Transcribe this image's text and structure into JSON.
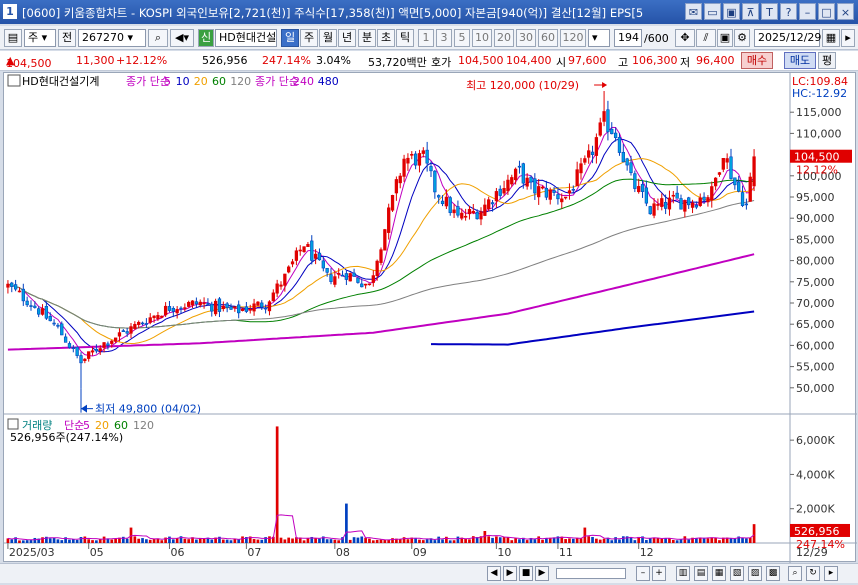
{
  "window": {
    "num": "1",
    "title": "[0600] 키움종합차트 - KOSPI 외국인보유[2,721(천)] 주식수[17,358(천)] 액면[5,000] 자본금[940(억)] 결산[12월] EPS[5",
    "controls": [
      "✉",
      "▭",
      "▣",
      "⊼",
      "T",
      "?",
      "–",
      "□",
      "×"
    ]
  },
  "toolbar": {
    "market": "주",
    "jeon": "전",
    "code": "267270",
    "stock_badge": "신",
    "stock_name": "HD현대건설",
    "periods": [
      "일",
      "주",
      "월",
      "년",
      "분",
      "초",
      "틱"
    ],
    "intervals": [
      "1",
      "3",
      "5",
      "10",
      "20",
      "30",
      "60",
      "120"
    ],
    "count": "194",
    "count_total": "/600",
    "date": "2025/12/29"
  },
  "quote": {
    "price": "104,500",
    "change": "11,300",
    "change_pct": "+12.12%",
    "volume": "526,956",
    "vol_ratio": "247.14%",
    "turnover": "3.04%",
    "amount": "53,720백만",
    "ask_label": "호가",
    "ask": "104,500",
    "bid": "104,400",
    "open_label": "시",
    "open": "97,600",
    "high_label": "고",
    "high": "106,300",
    "low_label": "저",
    "low": "96,400",
    "buy_btn": "매수",
    "sell_btn": "매도",
    "eval_btn": "평"
  },
  "chart_data": {
    "type": "candlestick",
    "stock_label": "HD현대건설기계",
    "legend": [
      {
        "text": "종가 단순",
        "color": "#c000c0"
      },
      {
        "text": "5",
        "color": "#c000c0"
      },
      {
        "text": "10",
        "color": "#0000c0"
      },
      {
        "text": "20",
        "color": "#f0a000"
      },
      {
        "text": "60",
        "color": "#008000"
      },
      {
        "text": "120",
        "color": "#808080"
      },
      {
        "text": "종가 단순",
        "color": "#c000c0"
      },
      {
        "text": "240",
        "color": "#c000c0"
      },
      {
        "text": "480",
        "color": "#0000c0"
      }
    ],
    "lc": "LC:109.84",
    "hc": "HC:-12.92",
    "ylim": [
      45000,
      120000
    ],
    "yticks": [
      50000,
      55000,
      60000,
      65000,
      70000,
      75000,
      80000,
      85000,
      90000,
      95000,
      100000,
      105000,
      110000,
      115000
    ],
    "ytick_labels": [
      "50,000",
      "55,000",
      "60,000",
      "65,000",
      "70,000",
      "75,000",
      "80,000",
      "85,000",
      "90,000",
      "95,000",
      "100,000",
      "105,000",
      "110,000",
      "115,000"
    ],
    "current_price": 104500,
    "current_label": "104,500",
    "current_pct": "12.12%",
    "high_annotation": "최고 120,000 (10/29)",
    "high_value": 120000,
    "low_annotation": "최저 49,800 (04/02)",
    "low_value": 49800,
    "ohlc_anchors": [
      [
        "2025-03-04",
        74000
      ],
      [
        "2025-03-14",
        70000
      ],
      [
        "2025-03-24",
        64000
      ],
      [
        "2025-04-02",
        56000
      ],
      [
        "2025-04-10",
        60000
      ],
      [
        "2025-04-22",
        64000
      ],
      [
        "2025-05-08",
        69000
      ],
      [
        "2025-05-20",
        70000
      ],
      [
        "2025-06-03",
        68000
      ],
      [
        "2025-06-16",
        70000
      ],
      [
        "2025-06-24",
        76000
      ],
      [
        "2025-07-01",
        84000
      ],
      [
        "2025-07-10",
        76000
      ],
      [
        "2025-07-18",
        77000
      ],
      [
        "2025-07-28",
        74000
      ],
      [
        "2025-08-04",
        91000
      ],
      [
        "2025-08-11",
        104000
      ],
      [
        "2025-08-18",
        104000
      ],
      [
        "2025-08-22",
        97000
      ],
      [
        "2025-09-01",
        90000
      ],
      [
        "2025-09-10",
        92000
      ],
      [
        "2025-09-18",
        97000
      ],
      [
        "2025-09-25",
        101000
      ],
      [
        "2025-10-01",
        97000
      ],
      [
        "2025-10-14",
        95000
      ],
      [
        "2025-10-23",
        104000
      ],
      [
        "2025-10-29",
        113000
      ],
      [
        "2025-11-03",
        110000
      ],
      [
        "2025-11-10",
        99000
      ],
      [
        "2025-11-18",
        92000
      ],
      [
        "2025-11-26",
        94000
      ],
      [
        "2025-12-04",
        94000
      ],
      [
        "2025-12-12",
        96000
      ],
      [
        "2025-12-17",
        106000
      ],
      [
        "2025-12-22",
        98000
      ],
      [
        "2025-12-26",
        93000
      ],
      [
        "2025-12-29",
        104500
      ]
    ],
    "ma240": [
      [
        0,
        59000
      ],
      [
        50,
        60500
      ],
      [
        95,
        63000
      ],
      [
        130,
        67500
      ],
      [
        160,
        74000
      ],
      [
        194,
        81500
      ]
    ],
    "ma480": [
      [
        110,
        60300
      ],
      [
        130,
        60200
      ],
      [
        160,
        64000
      ],
      [
        194,
        68000
      ]
    ],
    "volume_panel": {
      "title": "거래량",
      "legend": [
        {
          "text": "단순",
          "color": "#c000c0"
        },
        {
          "text": "5",
          "color": "#c000c0"
        },
        {
          "text": "20",
          "color": "#f0a000"
        },
        {
          "text": "60",
          "color": "#008000"
        },
        {
          "text": "120",
          "color": "#808080"
        }
      ],
      "value_label": "526,956주(247.14%)",
      "ylim": [
        0,
        7000000
      ],
      "yticks": [
        2000000,
        4000000,
        6000000
      ],
      "ytick_labels": [
        "2,000K",
        "4,000K",
        "6,000K"
      ],
      "current": 526956,
      "current_label": "526,956",
      "current_pct": "247.14%",
      "spikes": [
        [
          32,
          900000
        ],
        [
          70,
          6800000
        ],
        [
          88,
          2300000
        ],
        [
          124,
          700000
        ],
        [
          150,
          900000
        ],
        [
          194,
          1100000
        ]
      ]
    },
    "x_labels": [
      {
        "i": 0,
        "t": "2025/03"
      },
      {
        "i": 21,
        "t": "05"
      },
      {
        "i": 42,
        "t": "06"
      },
      {
        "i": 62,
        "t": "07"
      },
      {
        "i": 85,
        "t": "08"
      },
      {
        "i": 105,
        "t": "09"
      },
      {
        "i": 127,
        "t": "10"
      },
      {
        "i": 143,
        "t": "11"
      },
      {
        "i": 164,
        "t": "12"
      }
    ],
    "x_end_label": "12/29"
  }
}
